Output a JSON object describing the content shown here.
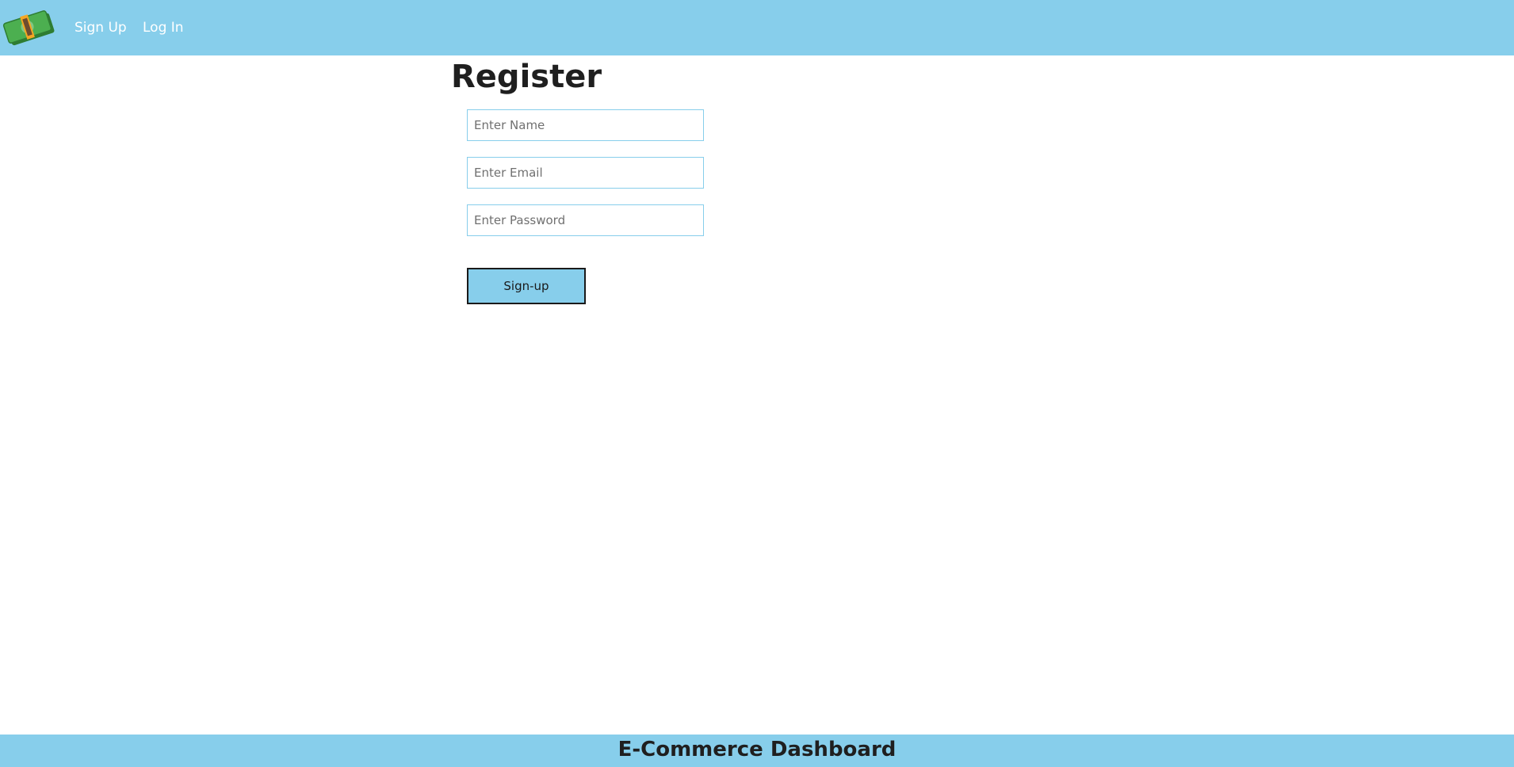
{
  "nav": {
    "logo_icon": "money-stack-icon",
    "links": [
      {
        "label": "Sign Up"
      },
      {
        "label": "Log In"
      }
    ]
  },
  "form": {
    "title": "Register",
    "name_placeholder": "Enter Name",
    "email_placeholder": "Enter Email",
    "password_placeholder": "Enter Password",
    "submit_label": "Sign-up"
  },
  "footer": {
    "title": "E-Commerce Dashboard"
  },
  "colors": {
    "accent": "#87ceeb",
    "nav_text": "#ffffff",
    "heading_text": "#1f1f1f",
    "button_border": "#1a1a1a"
  }
}
